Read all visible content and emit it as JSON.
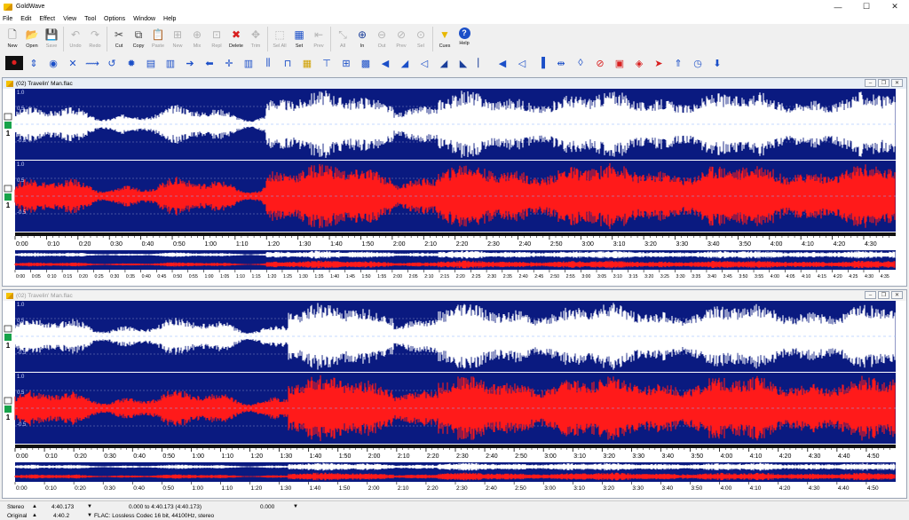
{
  "app": {
    "title": "GoldWave"
  },
  "window_controls": {
    "minimize": "—",
    "maximize": "☐",
    "close": "✕"
  },
  "menu": [
    "File",
    "Edit",
    "Effect",
    "View",
    "Tool",
    "Options",
    "Window",
    "Help"
  ],
  "toolbar": [
    {
      "label": "New",
      "icon": "new-file-icon",
      "enabled": true
    },
    {
      "label": "Open",
      "icon": "open-folder-icon",
      "enabled": true
    },
    {
      "label": "Save",
      "icon": "save-icon",
      "enabled": false
    },
    {
      "label": "Undo",
      "icon": "undo-icon",
      "enabled": false
    },
    {
      "label": "Redo",
      "icon": "redo-icon",
      "enabled": false
    },
    {
      "label": "Cut",
      "icon": "cut-icon",
      "enabled": true
    },
    {
      "label": "Copy",
      "icon": "copy-icon",
      "enabled": true
    },
    {
      "label": "Paste",
      "icon": "paste-icon",
      "enabled": false
    },
    {
      "label": "New",
      "icon": "paste-new-icon",
      "enabled": false
    },
    {
      "label": "Mix",
      "icon": "mix-icon",
      "enabled": false
    },
    {
      "label": "Repl",
      "icon": "replace-icon",
      "enabled": false
    },
    {
      "label": "Delete",
      "icon": "delete-icon",
      "enabled": true
    },
    {
      "label": "Trim",
      "icon": "trim-icon",
      "enabled": false
    },
    {
      "label": "Sel All",
      "icon": "select-all-icon",
      "enabled": false
    },
    {
      "label": "Set",
      "icon": "set-marker-icon",
      "enabled": true
    },
    {
      "label": "Prev",
      "icon": "previous-icon",
      "enabled": false
    },
    {
      "label": "All",
      "icon": "zoom-all-icon",
      "enabled": false
    },
    {
      "label": "In",
      "icon": "zoom-in-icon",
      "enabled": true
    },
    {
      "label": "Out",
      "icon": "zoom-out-icon",
      "enabled": false
    },
    {
      "label": "Prev",
      "icon": "zoom-previous-icon",
      "enabled": false
    },
    {
      "label": "Sel",
      "icon": "zoom-selection-icon",
      "enabled": false
    },
    {
      "label": "Cues",
      "icon": "cues-icon",
      "enabled": true
    },
    {
      "label": "Help",
      "icon": "help-icon",
      "enabled": true
    }
  ],
  "effects_toolbar": [
    "record-icon",
    "expand-icon",
    "volume-icon",
    "cross-icon",
    "bounce-icon",
    "loop-icon",
    "gear-icon",
    "filter-icon",
    "equalizer-icon",
    "right-arrow-icon",
    "left-arrow-icon",
    "target-icon",
    "mixer-icon",
    "sliders-icon",
    "columns-icon",
    "color-bars-icon",
    "spectrum-icon",
    "noise-icon",
    "compressor-icon",
    "speaker-icon",
    "fade-icon",
    "pitch-icon",
    "ramp-up-icon",
    "ramp-down-icon",
    "marker-icon",
    "mute-icon",
    "speaker-alt-icon",
    "delay-icon",
    "wave-icon",
    "waveform-icon",
    "stop-icon",
    "record-square-icon",
    "pattern-icon",
    "doppler-icon",
    "ascend-icon",
    "clock-icon",
    "download-icon"
  ],
  "documents": [
    {
      "title": "(02) Travelin' Man.flac",
      "active": true,
      "y_ticks": [
        "1.0",
        "0.5",
        "-0.5",
        "1.0",
        "0.5",
        "-0.5"
      ],
      "time_ticks": [
        "0:00",
        "0:10",
        "0:20",
        "0:30",
        "0:40",
        "0:50",
        "1:00",
        "1:10",
        "1:20",
        "1:30",
        "1:40",
        "1:50",
        "2:00",
        "2:10",
        "2:20",
        "2:30",
        "2:40",
        "2:50",
        "3:00",
        "3:10",
        "3:20",
        "3:30",
        "3:40",
        "3:50",
        "4:00",
        "4:10",
        "4:20",
        "4:30"
      ],
      "overview_ticks": [
        "0:00",
        "0:05",
        "0:10",
        "0:15",
        "0:20",
        "0:25",
        "0:30",
        "0:35",
        "0:40",
        "0:45",
        "0:50",
        "0:55",
        "1:00",
        "1:05",
        "1:10",
        "1:15",
        "1:20",
        "1:25",
        "1:30",
        "1:35",
        "1:40",
        "1:45",
        "1:50",
        "1:55",
        "2:00",
        "2:05",
        "2:10",
        "2:15",
        "2:20",
        "2:25",
        "2:30",
        "2:35",
        "2:40",
        "2:45",
        "2:50",
        "2:55",
        "3:00",
        "3:05",
        "3:10",
        "3:15",
        "3:20",
        "3:25",
        "3:30",
        "3:35",
        "3:40",
        "3:45",
        "3:50",
        "3:55",
        "4:00",
        "4:05",
        "4:10",
        "4:15",
        "4:20",
        "4:25",
        "4:30",
        "4:35"
      ],
      "channels": [
        "1",
        "1"
      ]
    },
    {
      "title": "(02) Travelin' Man.flac",
      "active": false,
      "y_ticks": [
        "1.0",
        "0.5",
        "-0.5",
        "1.0",
        "0.5",
        "-0.5"
      ],
      "time_ticks": [
        "0:00",
        "0:10",
        "0:20",
        "0:30",
        "0:40",
        "0:50",
        "1:00",
        "1:10",
        "1:20",
        "1:30",
        "1:40",
        "1:50",
        "2:00",
        "2:10",
        "2:20",
        "2:30",
        "2:40",
        "2:50",
        "3:00",
        "3:10",
        "3:20",
        "3:30",
        "3:40",
        "3:50",
        "4:00",
        "4:10",
        "4:20",
        "4:30",
        "4:40",
        "4:50"
      ],
      "overview_ticks": [
        "0:00",
        "0:10",
        "0:20",
        "0:30",
        "0:40",
        "0:50",
        "1:00",
        "1:10",
        "1:20",
        "1:30",
        "1:40",
        "1:50",
        "2:00",
        "2:10",
        "2:20",
        "2:30",
        "2:40",
        "2:50",
        "3:00",
        "3:10",
        "3:20",
        "3:30",
        "3:40",
        "3:50",
        "4:00",
        "4:10",
        "4:20",
        "4:30",
        "4:40",
        "4:50"
      ],
      "channels": [
        "1",
        "1"
      ]
    }
  ],
  "status": {
    "row1": {
      "mode": "Stereo",
      "length": "4:40.173",
      "selection": "0.000 to 4:40.173 (4:40.173)",
      "position": "0.000"
    },
    "row2": {
      "mode": "Original",
      "length": "4:40.2",
      "format": "FLAC: Lossless Codec 16 bit, 44100Hz, stereo"
    }
  },
  "colors": {
    "wave_bg": "#0a1a80",
    "left_channel": "#ffffff",
    "right_channel": "#ff1a1a",
    "accent": "#1b4fc8"
  }
}
